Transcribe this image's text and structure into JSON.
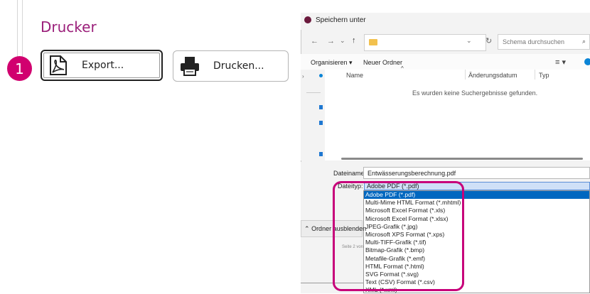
{
  "left": {
    "title": "Drucker",
    "step": "1",
    "export_label": "Export...",
    "print_label": "Drucken..."
  },
  "dialog": {
    "title": "Speichern unter",
    "search_placeholder": "Schema durchsuchen",
    "toolbar": {
      "organize": "Organisieren ▾",
      "new_folder": "Neuer Ordner"
    },
    "columns": {
      "name": "Name",
      "date": "Änderungsdatum",
      "type": "Typ"
    },
    "empty_message": "Es wurden keine Suchergebnisse gefunden.",
    "filename_label": "Dateiname:",
    "filename_value": "Entwässerungsberechnung.pdf",
    "filetype_label": "Dateityp:",
    "filetype_value": "Adobe PDF (*.pdf)",
    "hide_folders": "Ordner ausblenden",
    "page_hint": "Seite 2 von",
    "options": [
      "Adobe PDF (*.pdf)",
      "Multi-Mime HTML Format (*.mhtml)",
      "Microsoft Excel Format (*.xls)",
      "Microsoft Excel Format (*.xlsx)",
      "JPEG-Grafik (*.jpg)",
      "Microsoft XPS Format (*.xps)",
      "Multi-TIFF-Grafik (*.tif)",
      "Bitmap-Grafik (*.bmp)",
      "Metafile-Grafik (*.emf)",
      "HTML Format (*.html)",
      "SVG Format (*.svg)",
      "Text (CSV) Format (*.csv)",
      "XML (*.xml)"
    ],
    "selected_index": 0
  },
  "colors": {
    "accent": "#9b1f7a",
    "step": "#d1006f",
    "highlight": "#c7007a",
    "selection": "#0067c0"
  },
  "icons": [
    "pdf-export-icon",
    "printer-icon",
    "back-arrow-icon",
    "forward-arrow-icon",
    "up-arrow-icon",
    "folder-icon",
    "refresh-icon",
    "search-icon",
    "view-icon",
    "help-icon"
  ]
}
